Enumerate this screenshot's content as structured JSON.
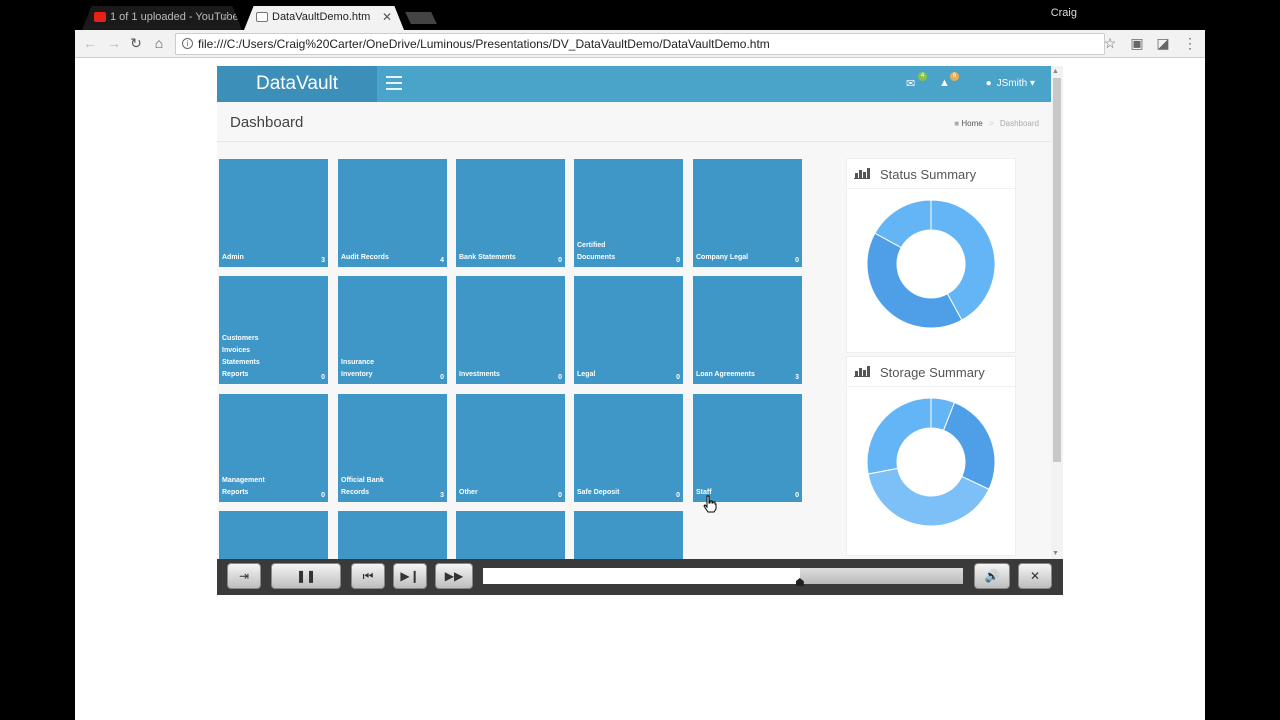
{
  "browser": {
    "tabs": [
      {
        "title": "1 of 1 uploaded - YouTube",
        "active": false
      },
      {
        "title": "DataVaultDemo.htm",
        "active": true
      }
    ],
    "profile_name": "Craig",
    "url": "file:///C:/Users/Craig%20Carter/OneDrive/Luminous/Presentations/DV_DataVaultDemo/DataVaultDemo.htm"
  },
  "app": {
    "brand": "DataVault",
    "header": {
      "mail_badge": "4",
      "alert_badge": "6",
      "user_name": "JSmith",
      "colors": {
        "header": "#4aa3c9",
        "logo": "#3c8fb8",
        "tile": "#3e97c6"
      }
    },
    "page_title": "Dashboard",
    "breadcrumb": {
      "home": "Home",
      "current": "Dashboard"
    },
    "tiles": [
      {
        "name": "Admin",
        "count": "3"
      },
      {
        "name": "Audit Records",
        "count": "4"
      },
      {
        "name": "Bank Statements",
        "count": "0"
      },
      {
        "name": "Certified\nDocuments",
        "count": "0"
      },
      {
        "name": "Company Legal",
        "count": "0"
      },
      {
        "name": "Customers\nInvoices\nStatements\nReports",
        "count": "0"
      },
      {
        "name": "Insurance\nInventory",
        "count": "0"
      },
      {
        "name": "Investments",
        "count": "0"
      },
      {
        "name": "Legal",
        "count": "0"
      },
      {
        "name": "Loan Agreements",
        "count": "3"
      },
      {
        "name": "Management\nReports",
        "count": "0"
      },
      {
        "name": "Official Bank\nRecords",
        "count": "3"
      },
      {
        "name": "Other",
        "count": "0"
      },
      {
        "name": "Safe Deposit",
        "count": "0"
      },
      {
        "name": "Staff",
        "count": "0"
      },
      {
        "name": "",
        "count": ""
      },
      {
        "name": "",
        "count": ""
      },
      {
        "name": "",
        "count": ""
      },
      {
        "name": "",
        "count": ""
      }
    ],
    "status_summary": {
      "title": "Status Summary",
      "segment_colors": [
        "#64b5f6",
        "#4e9fe8"
      ],
      "segments": [
        0.42,
        0.41,
        0.17
      ]
    },
    "storage_summary": {
      "title": "Storage Summary",
      "segment_colors": [
        "#64b5f6",
        "#4e9fe8",
        "#7cc0f7"
      ],
      "segments": [
        0.06,
        0.26,
        0.4,
        0.28
      ]
    }
  },
  "player": {
    "progress": 0.66,
    "buttons": [
      "exit-icon",
      "pause-icon",
      "skip-back-icon",
      "step-forward-icon",
      "fast-forward-icon",
      "volume-icon",
      "close-icon"
    ]
  }
}
